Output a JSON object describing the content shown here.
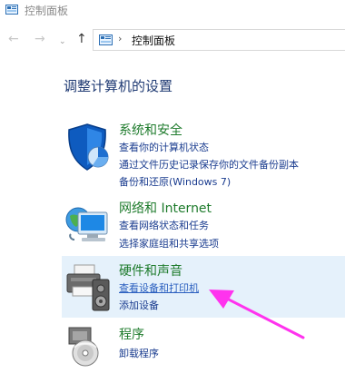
{
  "window": {
    "title": "控制面板"
  },
  "nav": {
    "back": "←",
    "forward": "→",
    "recent": "⌄",
    "up": "↑"
  },
  "address": {
    "separator": "›",
    "crumb": "控制面板"
  },
  "page": {
    "title": "调整计算机的设置"
  },
  "categories": [
    {
      "title": "系统和安全",
      "icon": "security-shield-icon",
      "links": [
        "查看你的计算机状态",
        "通过文件历史记录保存你的文件备份副本",
        "备份和还原(Windows 7)"
      ]
    },
    {
      "title": "网络和 Internet",
      "icon": "network-globe-icon",
      "links": [
        "查看网络状态和任务",
        "选择家庭组和共享选项"
      ]
    },
    {
      "title": "硬件和声音",
      "icon": "printer-speaker-icon",
      "links": [
        "查看设备和打印机",
        "添加设备"
      ]
    },
    {
      "title": "程序",
      "icon": "programs-disc-icon",
      "links": [
        "卸载程序"
      ]
    }
  ],
  "colors": {
    "highlight": "#e5f1fb",
    "category_title": "#1e7b2c",
    "link": "#1a3c8f",
    "arrow": "#ff33ee"
  }
}
